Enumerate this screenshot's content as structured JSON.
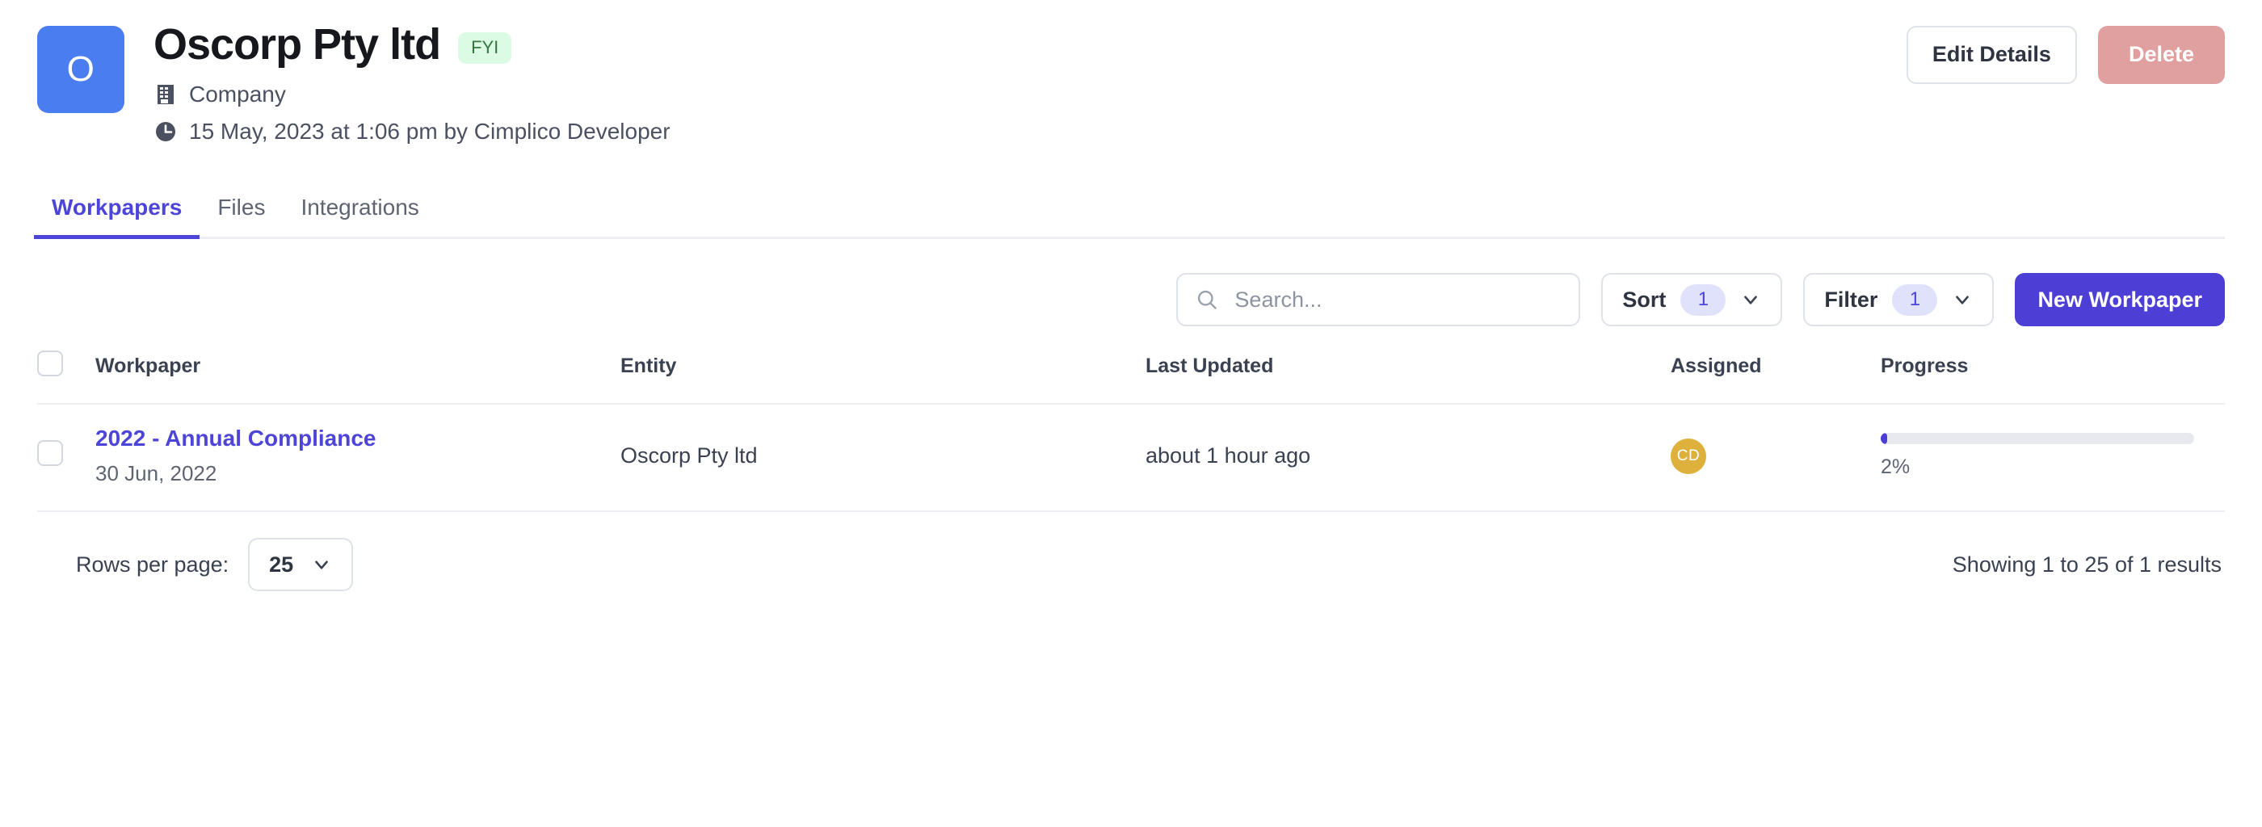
{
  "header": {
    "avatar_initial": "O",
    "avatar_color": "#4a7df0",
    "title": "Oscorp Pty ltd",
    "badge": "FYI",
    "badge_bg": "#dcfbe4",
    "badge_color": "#35773f",
    "entity_type": "Company",
    "entity_type_icon": "building-icon",
    "timestamp": "15 May, 2023 at 1:06 pm by Cimplico Developer",
    "timestamp_icon": "clock-icon",
    "edit_button": "Edit Details",
    "delete_button": "Delete",
    "delete_color": "#e0a0a0"
  },
  "tabs": [
    {
      "label": "Workpapers",
      "active": true
    },
    {
      "label": "Files",
      "active": false
    },
    {
      "label": "Integrations",
      "active": false
    }
  ],
  "toolbar": {
    "search_placeholder": "Search...",
    "search_value": "",
    "search_icon": "search-icon",
    "sort_label": "Sort",
    "sort_count": "1",
    "filter_label": "Filter",
    "filter_count": "1",
    "new_button": "New Workpaper",
    "accent_color": "#4d3fd6",
    "badge_bg": "#e0e2fb"
  },
  "table": {
    "columns": [
      "Workpaper",
      "Entity",
      "Last Updated",
      "Assigned",
      "Progress"
    ],
    "rows": [
      {
        "workpaper": "2022 - Annual Compliance",
        "workpaper_date": "30 Jun, 2022",
        "entity": "Oscorp Pty ltd",
        "last_updated": "about 1 hour ago",
        "assigned_initials": "CD",
        "assigned_color": "#ddb13c",
        "progress_percent": 2,
        "progress_label": "2%"
      }
    ]
  },
  "footer": {
    "rows_per_page_label": "Rows per page:",
    "rows_per_page_value": "25",
    "showing_text": "Showing 1 to 25 of 1 results"
  }
}
